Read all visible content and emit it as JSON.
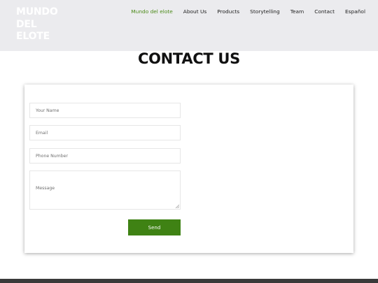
{
  "brand": {
    "line1": "MUNDO",
    "line2": "DEL",
    "line3": "ELOTE"
  },
  "nav": {
    "items": [
      {
        "label": "Mundo del elote"
      },
      {
        "label": "About Us"
      },
      {
        "label": "Products"
      },
      {
        "label": "Storytelling"
      },
      {
        "label": "Team"
      },
      {
        "label": "Contact"
      },
      {
        "label": "Español"
      }
    ],
    "active_index": 0
  },
  "page": {
    "title": "CONTACT US"
  },
  "form": {
    "name_placeholder": "Your Name",
    "email_placeholder": "Email",
    "phone_placeholder": "Phone Number",
    "message_placeholder": "Message",
    "send_label": "Send"
  },
  "colors": {
    "header_bg": "#ebebee",
    "accent": "#4b8a18",
    "button": "#3f8214",
    "footer": "#3a3a3a"
  }
}
